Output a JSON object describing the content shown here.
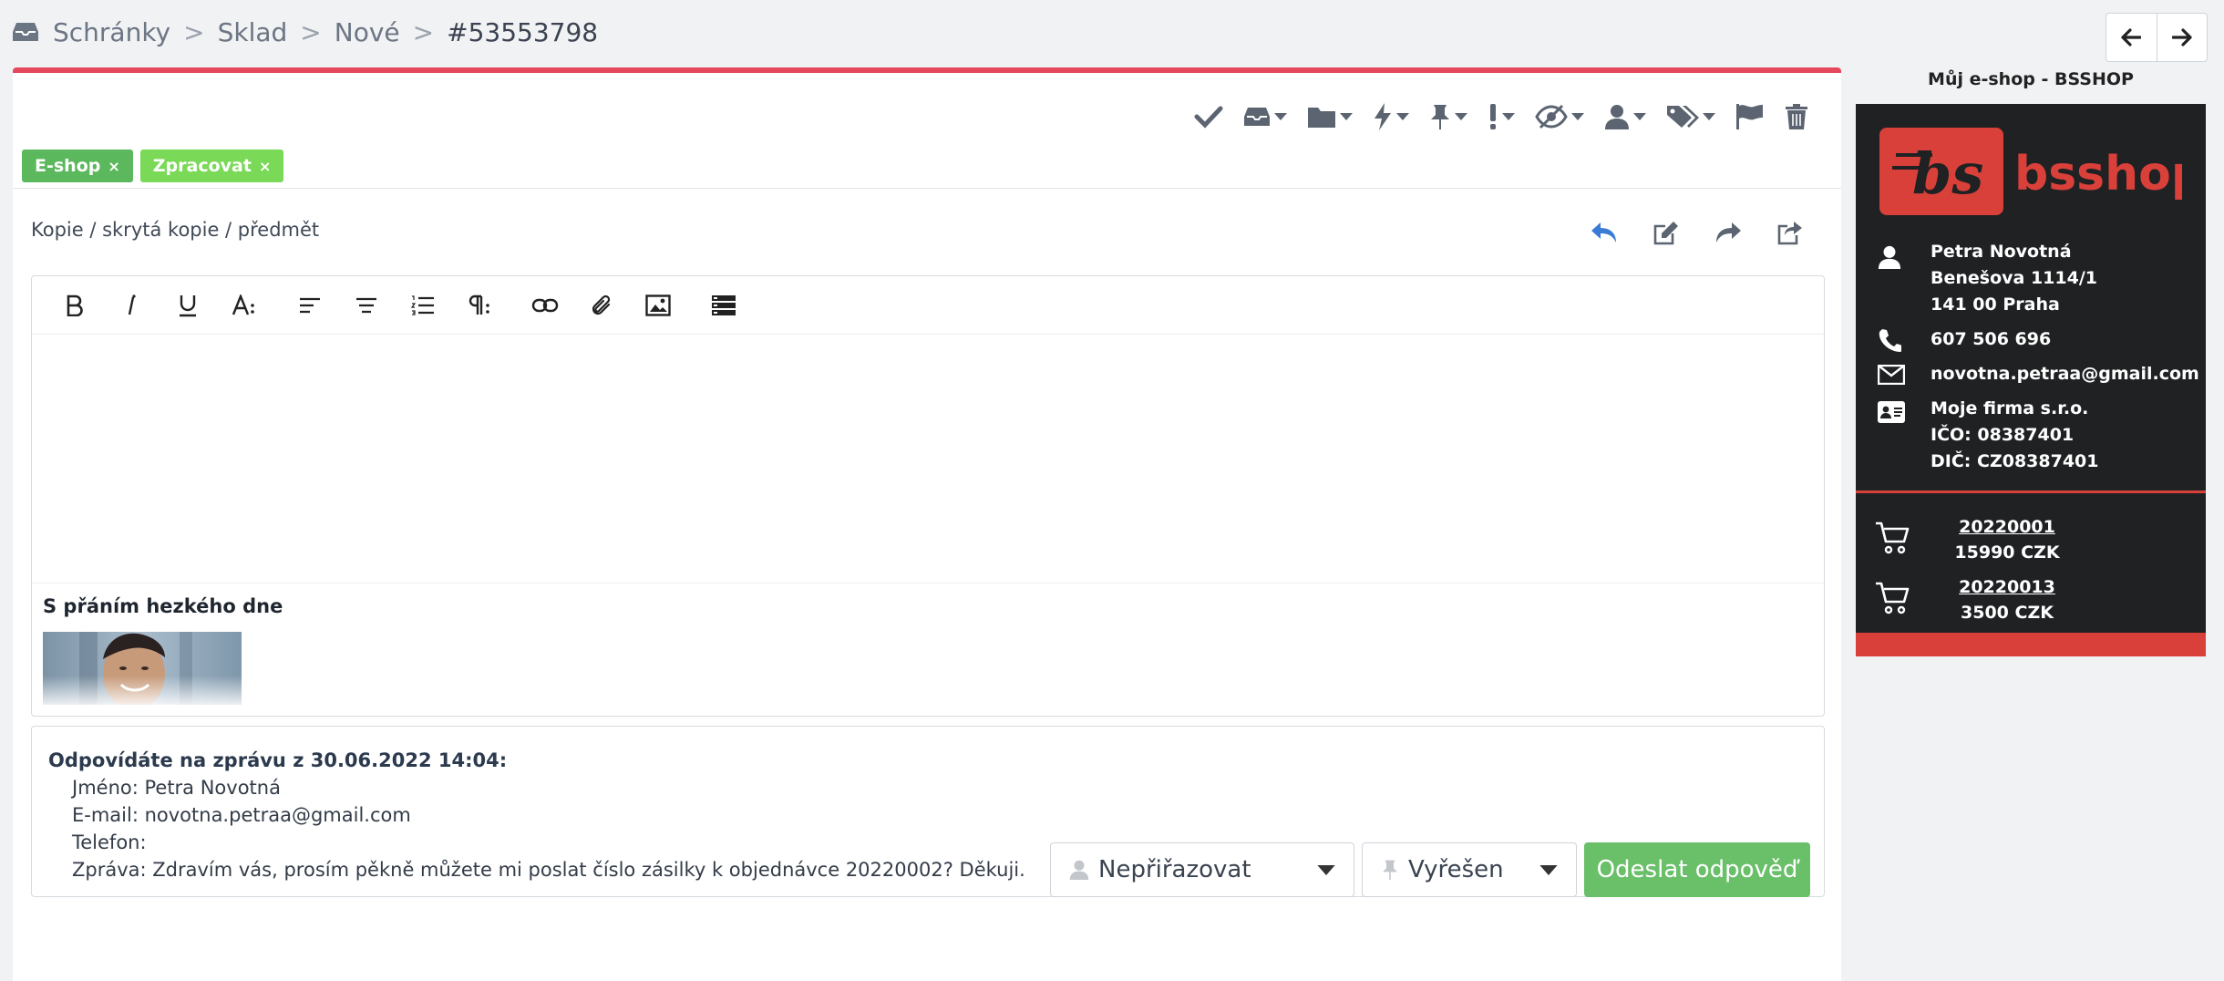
{
  "breadcrumb": {
    "items": [
      "Schránky",
      "Sklad",
      "Nové"
    ],
    "separator": ">",
    "current": "#53553798"
  },
  "toolbar": {
    "icons": [
      "check-icon",
      "inbox-icon",
      "folder-icon",
      "bolt-icon",
      "pin-icon",
      "exclamation-icon",
      "eye-slash-icon",
      "user-icon",
      "tags-icon",
      "flag-icon",
      "trash-icon"
    ]
  },
  "tags": [
    {
      "label": "E-shop",
      "close": "×",
      "color": "#5cb85c"
    },
    {
      "label": "Zpracovat",
      "close": "×",
      "color": "#7ad957"
    }
  ],
  "compose": {
    "cc_link": "Kopie / skrytá kopie / předmět"
  },
  "signature": {
    "text": "S přáním hezkého dne"
  },
  "quote": {
    "header": "Odpovídáte na zprávu z 30.06.2022 14:04:",
    "name": "Jméno: Petra Novotná",
    "email": "E-mail: novotna.petraa@gmail.com",
    "phone": "Telefon:",
    "message": "Zpráva: Zdravím vás, prosím pěkně můžete mi poslat číslo zásilky k objednávce 20220002? Děkuji."
  },
  "actions": {
    "assign_label": "Nepřiřazovat",
    "status_label": "Vyřešen",
    "send_label": "Odeslat odpověď"
  },
  "shop": {
    "title": "Můj e-shop - BSSHOP",
    "logo_text": "bsshop",
    "logo_mark": "bs",
    "customer": {
      "name": "Petra Novotná",
      "street": "Benešova 1114/1",
      "city": "141 00 Praha",
      "phone": "607 506 696",
      "email": "novotna.petraa@gmail.com",
      "company": "Moje firma s.r.o.",
      "ico": "IČO: 08387401",
      "dic": "DIČ: CZ08387401"
    },
    "orders": [
      {
        "number": "20220001",
        "amount": "15990 CZK"
      },
      {
        "number": "20220013",
        "amount": "3500 CZK"
      }
    ]
  },
  "colors": {
    "accent_red": "#e5485c",
    "send_green": "#6abf69",
    "reply_blue": "#3a7bd5",
    "card_bg": "#1f2123",
    "brand_red": "#d9403a"
  }
}
